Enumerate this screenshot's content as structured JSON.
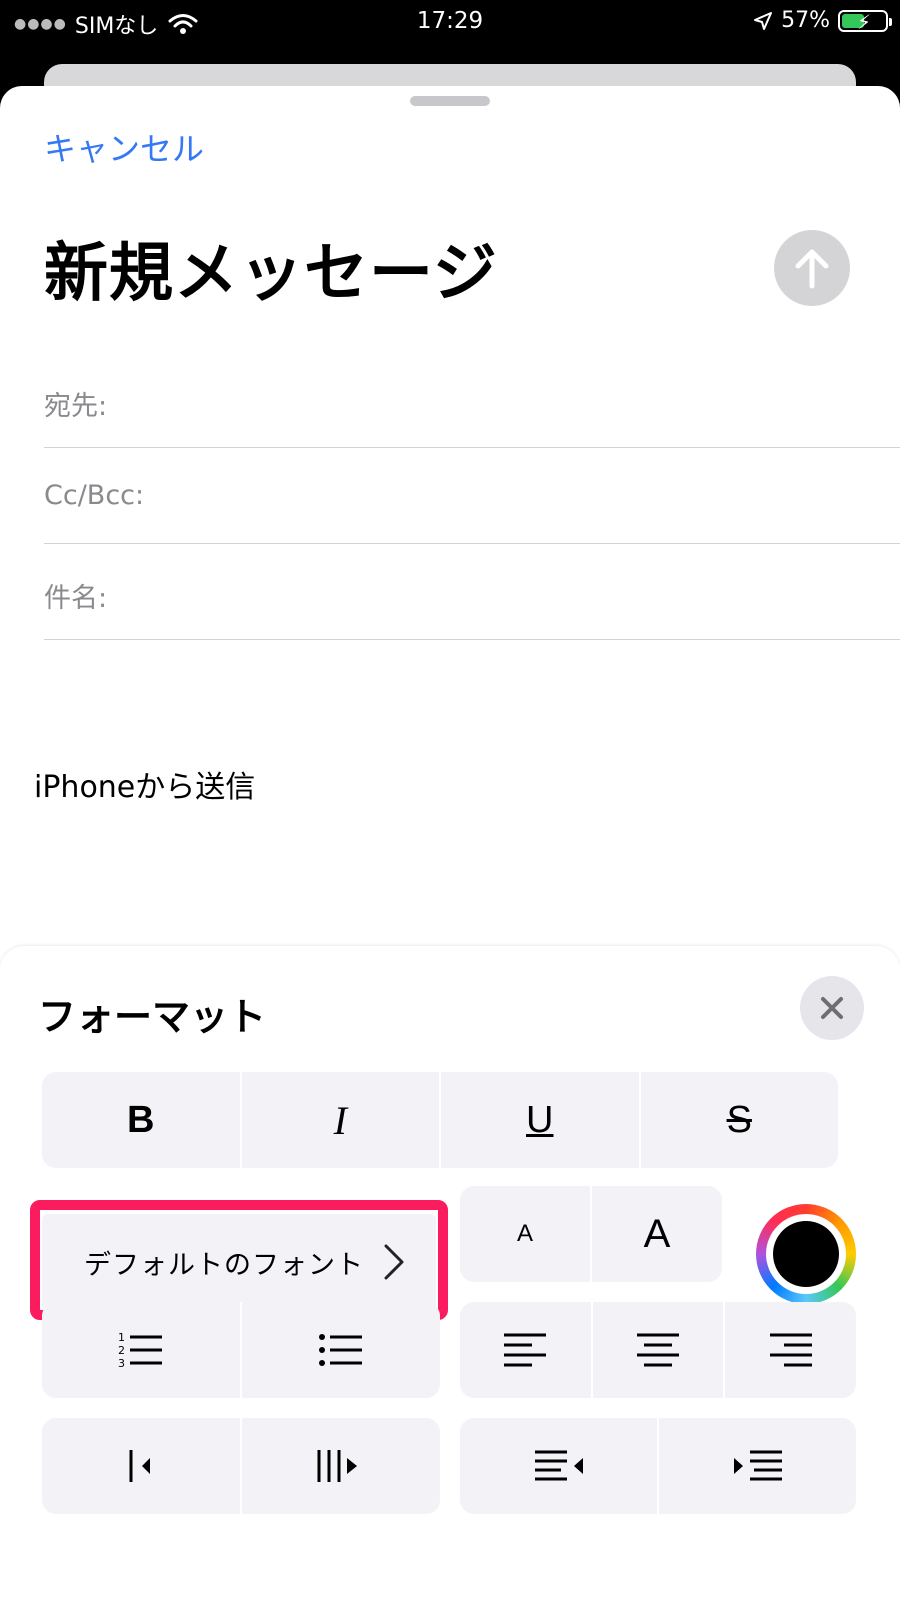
{
  "status_bar": {
    "carrier": "SIMなし",
    "time": "17:29",
    "battery": "57%"
  },
  "compose": {
    "cancel_label": "キャンセル",
    "title": "新規メッセージ",
    "fields": {
      "to_label": "宛先:",
      "cc_label": "Cc/Bcc:",
      "subject_label": "件名:"
    },
    "body_text": "iPhoneから送信"
  },
  "format_panel": {
    "title": "フォーマット",
    "style_buttons": {
      "bold": "B",
      "italic": "I",
      "underline": "U",
      "strikethrough": "S"
    },
    "font_button_label": "デフォルトのフォント",
    "size_buttons": {
      "smaller": "A",
      "larger": "A"
    },
    "selected_color": "#000000",
    "highlight_color": "#fa1c5e"
  }
}
